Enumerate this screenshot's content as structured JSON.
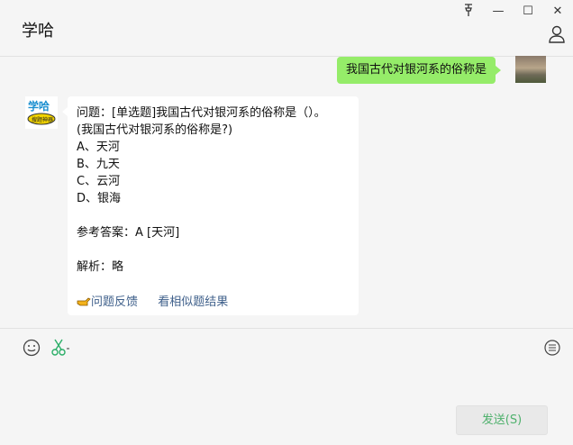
{
  "window": {
    "title": "学哈",
    "controls": {
      "pin": "-pin-icon",
      "minimize": "—",
      "maximize": "☐",
      "close": "✕"
    }
  },
  "chat": {
    "outgoing": {
      "text": "我国古代对银河系的俗称是"
    },
    "incoming": {
      "lines": [
        "问题：[单选题]我国古代对银河系的俗称是（）。",
        "(我国古代对银河系的俗称是?)",
        "A、天河",
        "B、九天",
        "C、云河",
        "D、银海",
        "",
        "参考答案：A [天河]",
        "",
        "解析：略"
      ],
      "feedback_link": "问题反馈",
      "similar_link": "看相似题结果"
    },
    "bot_avatar_text": "学哈",
    "bot_avatar_subtext": "搜题神器"
  },
  "composer": {
    "send_label": "发送(S)"
  },
  "colors": {
    "outgoing_bubble": "#95ec69",
    "link": "#3e5f8a",
    "send_text": "#4fb16d"
  }
}
